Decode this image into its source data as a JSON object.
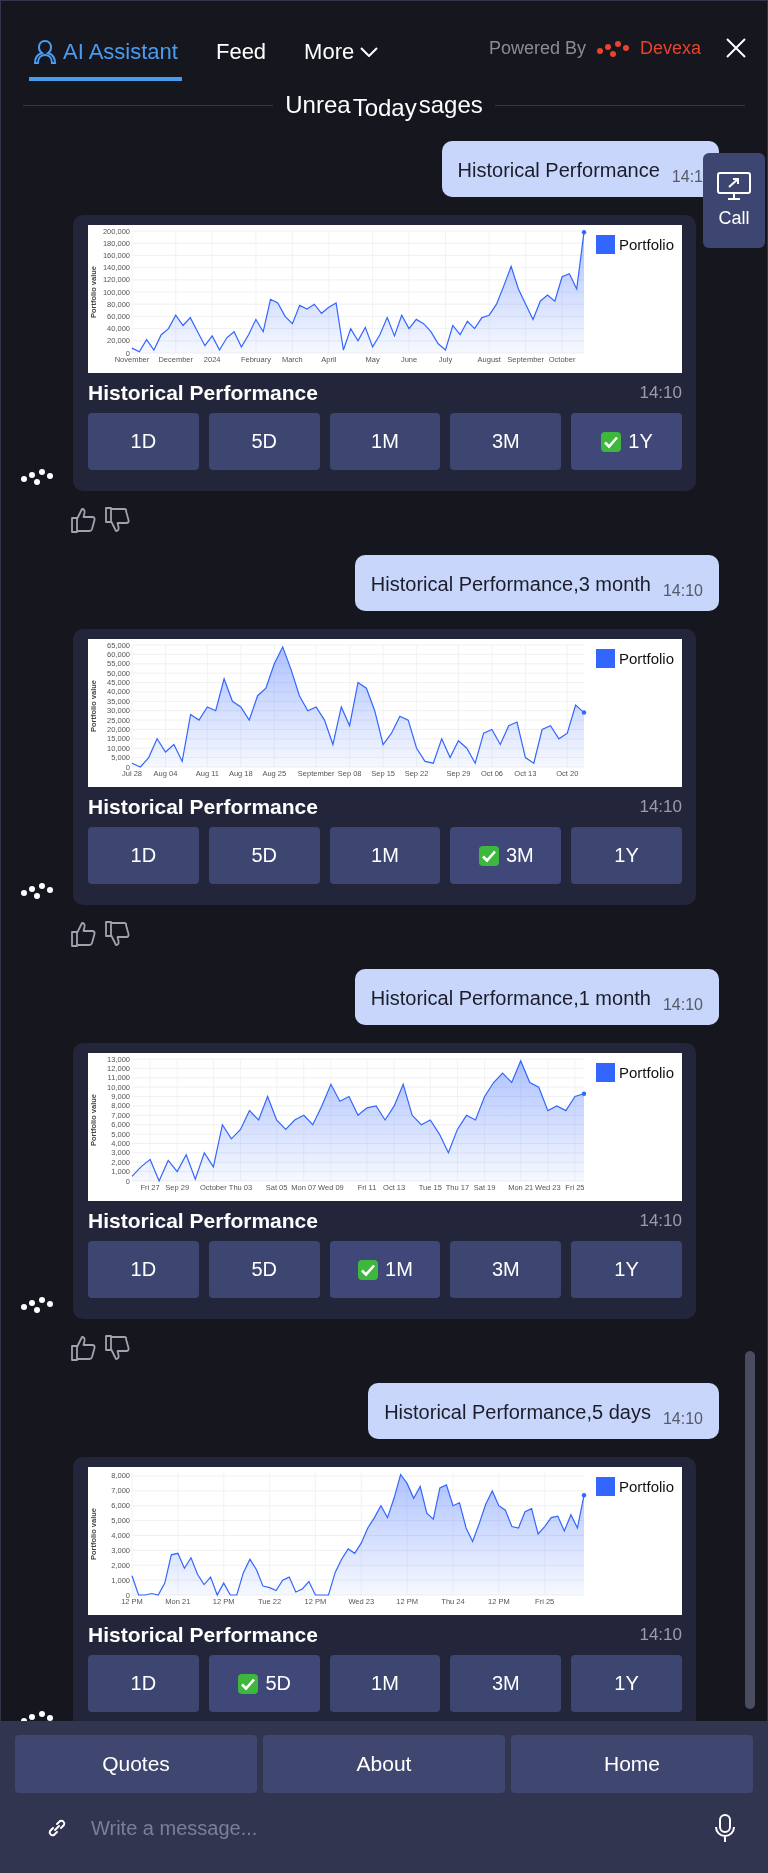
{
  "header": {
    "tabs": [
      {
        "label": "AI Assistant",
        "kind": "assistant",
        "selected": true
      },
      {
        "label": "Feed",
        "kind": "plain",
        "selected": false
      },
      {
        "label": "More",
        "kind": "menu",
        "selected": false
      }
    ],
    "powered_by": "Powered By",
    "brand": "Devexa"
  },
  "date_divider": {
    "left": "Unrea",
    "label": "Today",
    "right": "sages"
  },
  "call_button": {
    "label": "Call"
  },
  "messages": [
    {
      "kind": "user",
      "text": "Historical Performance",
      "time": "14:1"
    },
    {
      "kind": "bot",
      "title": "Historical Performance",
      "time": "14:10",
      "chart_data": {
        "type": "area",
        "grid": true,
        "ylabel": "Portfolio value",
        "ylim": [
          0,
          200000
        ],
        "yticks": [
          {
            "value": 0,
            "label": "0"
          },
          {
            "value": 20000,
            "label": "20,000"
          },
          {
            "value": 40000,
            "label": "40,000"
          },
          {
            "value": 60000,
            "label": "60,000"
          },
          {
            "value": 80000,
            "label": "80,000"
          },
          {
            "value": 100000,
            "label": "100,000"
          },
          {
            "value": 120000,
            "label": "120,000"
          },
          {
            "value": 140000,
            "label": "140,000"
          },
          {
            "value": 160000,
            "label": "160,000"
          },
          {
            "value": 180000,
            "label": "180,000"
          },
          {
            "value": 200000,
            "label": "200,000"
          }
        ],
        "categories": [
          "November",
          null,
          null,
          null,
          null,
          null,
          "December",
          null,
          null,
          null,
          null,
          "2024",
          null,
          null,
          null,
          null,
          null,
          "February",
          null,
          null,
          null,
          null,
          "March",
          null,
          null,
          null,
          null,
          "April",
          null,
          null,
          null,
          null,
          null,
          "May",
          null,
          null,
          null,
          null,
          "June",
          null,
          null,
          null,
          null,
          "July",
          null,
          null,
          null,
          null,
          null,
          "August",
          null,
          null,
          null,
          null,
          "September",
          null,
          null,
          null,
          null,
          "October",
          null,
          null,
          null
        ],
        "series": [
          {
            "name": "Portfolio",
            "color": "#3366ff",
            "values": [
              8000,
              2000,
              22000,
              5000,
              30000,
              40000,
              62000,
              45000,
              58000,
              35000,
              12000,
              28000,
              5000,
              25000,
              35000,
              10000,
              30000,
              55000,
              35000,
              88000,
              82000,
              60000,
              48000,
              78000,
              72000,
              80000,
              65000,
              75000,
              82000,
              5000,
              40000,
              20000,
              42000,
              10000,
              30000,
              58000,
              28000,
              62000,
              40000,
              55000,
              48000,
              35000,
              15000,
              5000,
              45000,
              30000,
              52000,
              40000,
              58000,
              62000,
              80000,
              110000,
              142000,
              105000,
              80000,
              55000,
              85000,
              95000,
              85000,
              125000,
              130000,
              105000,
              198000
            ]
          }
        ]
      },
      "periods": [
        {
          "label": "1D",
          "selected": false
        },
        {
          "label": "5D",
          "selected": false
        },
        {
          "label": "1M",
          "selected": false
        },
        {
          "label": "3M",
          "selected": false
        },
        {
          "label": "1Y",
          "selected": true
        }
      ],
      "feedback": true
    },
    {
      "kind": "user",
      "text": "Historical Performance,3 month",
      "time": "14:10"
    },
    {
      "kind": "bot",
      "title": "Historical Performance",
      "time": "14:10",
      "chart_data": {
        "type": "area",
        "grid": true,
        "ylabel": "Portfolio value",
        "ylim": [
          0,
          65000
        ],
        "yticks": [
          {
            "value": 0,
            "label": "0"
          },
          {
            "value": 5000,
            "label": "5,000"
          },
          {
            "value": 10000,
            "label": "10,000"
          },
          {
            "value": 15000,
            "label": "15,000"
          },
          {
            "value": 20000,
            "label": "20,000"
          },
          {
            "value": 25000,
            "label": "25,000"
          },
          {
            "value": 30000,
            "label": "30,000"
          },
          {
            "value": 35000,
            "label": "35,000"
          },
          {
            "value": 40000,
            "label": "40,000"
          },
          {
            "value": 45000,
            "label": "45,000"
          },
          {
            "value": 50000,
            "label": "50,000"
          },
          {
            "value": 55000,
            "label": "55,000"
          },
          {
            "value": 60000,
            "label": "60,000"
          },
          {
            "value": 65000,
            "label": "65,000"
          }
        ],
        "categories": [
          "Jul 28",
          null,
          null,
          null,
          "Aug 04",
          null,
          null,
          null,
          null,
          "Aug 11",
          null,
          null,
          null,
          "Aug 18",
          null,
          null,
          null,
          "Aug 25",
          null,
          null,
          null,
          null,
          "September",
          null,
          null,
          null,
          "Sep 08",
          null,
          null,
          null,
          "Sep 15",
          null,
          null,
          null,
          "Sep 22",
          null,
          null,
          null,
          null,
          "Sep 29",
          null,
          null,
          null,
          "Oct 06",
          null,
          null,
          null,
          "Oct 13",
          null,
          null,
          null,
          null,
          "Oct 20",
          null,
          null
        ],
        "series": [
          {
            "name": "Portfolio",
            "color": "#3366ff",
            "values": [
              2000,
              0,
              5000,
              15000,
              8000,
              12000,
              3000,
              28000,
              25000,
              32000,
              30000,
              47000,
              35000,
              32000,
              25000,
              38000,
              42000,
              55000,
              64000,
              52000,
              38000,
              30000,
              32000,
              25000,
              12000,
              32000,
              22000,
              45000,
              42000,
              30000,
              12000,
              18000,
              27000,
              25000,
              10000,
              3000,
              2000,
              15000,
              5000,
              14000,
              10000,
              2000,
              18000,
              20000,
              12000,
              22000,
              24000,
              5000,
              2000,
              20000,
              22000,
              15000,
              18000,
              33000,
              29000
            ]
          }
        ]
      },
      "periods": [
        {
          "label": "1D",
          "selected": false
        },
        {
          "label": "5D",
          "selected": false
        },
        {
          "label": "1M",
          "selected": false
        },
        {
          "label": "3M",
          "selected": true
        },
        {
          "label": "1Y",
          "selected": false
        }
      ],
      "feedback": true
    },
    {
      "kind": "user",
      "text": "Historical Performance,1 month",
      "time": "14:10"
    },
    {
      "kind": "bot",
      "title": "Historical Performance",
      "time": "14:10",
      "chart_data": {
        "type": "area",
        "grid": true,
        "ylabel": "Portfolio value",
        "ylim": [
          0,
          13000
        ],
        "yticks": [
          {
            "value": 0,
            "label": "0"
          },
          {
            "value": 1000,
            "label": "1,000"
          },
          {
            "value": 2000,
            "label": "2,000"
          },
          {
            "value": 3000,
            "label": "3,000"
          },
          {
            "value": 4000,
            "label": "4,000"
          },
          {
            "value": 5000,
            "label": "5,000"
          },
          {
            "value": 6000,
            "label": "6,000"
          },
          {
            "value": 7000,
            "label": "7,000"
          },
          {
            "value": 8000,
            "label": "8,000"
          },
          {
            "value": 9000,
            "label": "9,000"
          },
          {
            "value": 10000,
            "label": "10,000"
          },
          {
            "value": 11000,
            "label": "11,000"
          },
          {
            "value": 12000,
            "label": "12,000"
          },
          {
            "value": 13000,
            "label": "13,000"
          }
        ],
        "categories": [
          null,
          null,
          "Fri 27",
          null,
          null,
          "Sep 29",
          null,
          null,
          null,
          "October",
          null,
          null,
          "Thu 03",
          null,
          null,
          null,
          "Sat 05",
          null,
          null,
          "Mon 07",
          null,
          null,
          "Wed 09",
          null,
          null,
          null,
          "Fri 11",
          null,
          null,
          "Oct 13",
          null,
          null,
          null,
          "Tue 15",
          null,
          null,
          "Thu 17",
          null,
          null,
          "Sat 19",
          null,
          null,
          null,
          "Mon 21",
          null,
          null,
          "Wed 23",
          null,
          null,
          "Fri 25",
          null
        ],
        "series": [
          {
            "name": "Portfolio",
            "color": "#3366ff",
            "values": [
              500,
              1500,
              2300,
              0,
              2200,
              1000,
              2800,
              200,
              3000,
              1500,
              6000,
              4500,
              5500,
              7500,
              6500,
              9000,
              6500,
              5500,
              6500,
              7000,
              6000,
              8000,
              10300,
              8500,
              9000,
              7000,
              7800,
              8000,
              6500,
              8000,
              10300,
              7000,
              6000,
              6500,
              5000,
              3000,
              5500,
              7000,
              6500,
              9000,
              10500,
              11500,
              10500,
              12800,
              10500,
              10000,
              7500,
              8000,
              7500,
              9000,
              9300
            ]
          }
        ]
      },
      "periods": [
        {
          "label": "1D",
          "selected": false
        },
        {
          "label": "5D",
          "selected": false
        },
        {
          "label": "1M",
          "selected": true
        },
        {
          "label": "3M",
          "selected": false
        },
        {
          "label": "1Y",
          "selected": false
        }
      ],
      "feedback": true
    },
    {
      "kind": "user",
      "text": "Historical Performance,5 days",
      "time": "14:10"
    },
    {
      "kind": "bot",
      "title": "Historical Performance",
      "time": "14:10",
      "chart_data": {
        "type": "area",
        "grid": true,
        "ylabel": "Portfolio value",
        "ylim": [
          0,
          8200
        ],
        "yticks": [
          {
            "value": 0,
            "label": "0"
          },
          {
            "value": 1000,
            "label": "1,000"
          },
          {
            "value": 2000,
            "label": "2,000"
          },
          {
            "value": 3000,
            "label": "3,000"
          },
          {
            "value": 4000,
            "label": "4,000"
          },
          {
            "value": 5000,
            "label": "5,000"
          },
          {
            "value": 6000,
            "label": "6,000"
          },
          {
            "value": 7000,
            "label": "7,000"
          },
          {
            "value": 8000,
            "label": "8,000"
          }
        ],
        "categories": [
          "12 PM",
          null,
          null,
          null,
          null,
          null,
          null,
          "Mon 21",
          null,
          null,
          null,
          null,
          null,
          null,
          "12 PM",
          null,
          null,
          null,
          null,
          null,
          null,
          "Tue 22",
          null,
          null,
          null,
          null,
          null,
          null,
          "12 PM",
          null,
          null,
          null,
          null,
          null,
          null,
          "Wed 23",
          null,
          null,
          null,
          null,
          null,
          null,
          "12 PM",
          null,
          null,
          null,
          null,
          null,
          null,
          "Thu 24",
          null,
          null,
          null,
          null,
          null,
          null,
          "12 PM",
          null,
          null,
          null,
          null,
          null,
          null,
          "Fri 25",
          null,
          null,
          null,
          null,
          null,
          null
        ],
        "series": [
          {
            "name": "Portfolio",
            "color": "#3366ff",
            "values": [
              1300,
              0,
              0,
              100,
              0,
              800,
              2700,
              2800,
              1800,
              2500,
              1400,
              700,
              1200,
              0,
              800,
              0,
              0,
              1500,
              2400,
              1700,
              600,
              500,
              300,
              1000,
              1200,
              200,
              400,
              900,
              0,
              0,
              0,
              1500,
              2400,
              3100,
              2800,
              3500,
              4500,
              5200,
              6000,
              5200,
              6500,
              8100,
              7500,
              6500,
              7300,
              5500,
              5100,
              7200,
              7400,
              6000,
              6200,
              4500,
              3600,
              4800,
              6100,
              7000,
              6000,
              5700,
              4600,
              4500,
              5600,
              5800,
              4100,
              4600,
              5200,
              5300,
              4300,
              5400,
              4500,
              6700
            ]
          }
        ]
      },
      "periods": [
        {
          "label": "1D",
          "selected": false
        },
        {
          "label": "5D",
          "selected": true
        },
        {
          "label": "1M",
          "selected": false
        },
        {
          "label": "3M",
          "selected": false
        },
        {
          "label": "1Y",
          "selected": false
        }
      ],
      "feedback": false
    }
  ],
  "quick_replies": [
    "Quotes",
    "About",
    "Home"
  ],
  "composer": {
    "placeholder": "Write a message..."
  }
}
